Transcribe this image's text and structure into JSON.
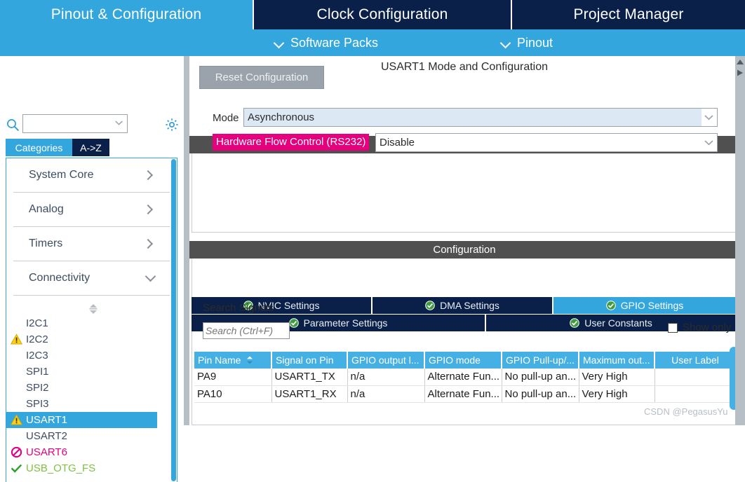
{
  "main_tabs": [
    {
      "label": "Pinout & Configuration",
      "active": true
    },
    {
      "label": "Clock Configuration",
      "active": false
    },
    {
      "label": "Project Manager",
      "active": false
    }
  ],
  "sub_tabs": [
    {
      "label": "Software Packs",
      "icon": "chevron-down-icon"
    },
    {
      "label": "Pinout",
      "icon": "chevron-down-icon"
    }
  ],
  "left_panel": {
    "search": {
      "value": "",
      "placeholder": "",
      "icon": "search-icon"
    },
    "settings_icon": "gear-icon",
    "view_tabs": [
      {
        "label": "Categories",
        "selected": true
      },
      {
        "label": "A->Z",
        "selected": false
      }
    ],
    "categories": [
      {
        "label": "System Core",
        "state": "collapsed"
      },
      {
        "label": "Analog",
        "state": "collapsed"
      },
      {
        "label": "Timers",
        "state": "collapsed"
      },
      {
        "label": "Connectivity",
        "state": "expanded"
      }
    ],
    "peripherals": [
      {
        "label": "I2C1",
        "badge": "none",
        "selected": false
      },
      {
        "label": "I2C2",
        "badge": "warning",
        "selected": false
      },
      {
        "label": "I2C3",
        "badge": "none",
        "selected": false
      },
      {
        "label": "SPI1",
        "badge": "none",
        "selected": false
      },
      {
        "label": "SPI2",
        "badge": "none",
        "selected": false
      },
      {
        "label": "SPI3",
        "badge": "none",
        "selected": false
      },
      {
        "label": "USART1",
        "badge": "warning",
        "selected": true
      },
      {
        "label": "USART2",
        "badge": "none",
        "selected": false
      },
      {
        "label": "USART6",
        "badge": "blocked",
        "selected": false
      },
      {
        "label": "USB_OTG_FS",
        "badge": "check",
        "selected": false
      }
    ]
  },
  "right_panel": {
    "title": "USART1 Mode and Configuration",
    "mode_section": {
      "header": "Mode",
      "fields": [
        {
          "label": "Mode",
          "value": "Asynchronous",
          "highlight": false
        },
        {
          "label": "Hardware Flow Control (RS232)",
          "value": "Disable",
          "highlight": true
        }
      ]
    },
    "config_section": {
      "header": "Configuration",
      "reset_button": "Reset Configuration",
      "tabs_row1": [
        {
          "label": "NVIC Settings",
          "active": false
        },
        {
          "label": "DMA Settings",
          "active": false
        },
        {
          "label": "GPIO Settings",
          "active": true
        }
      ],
      "tabs_row2": [
        {
          "label": "Parameter Settings",
          "active": false
        },
        {
          "label": "User Constants",
          "active": false
        }
      ],
      "search_signals_label": "Search Signals",
      "search_signals_placeholder": "Search (Ctrl+F)",
      "show_only_label": "Show only",
      "show_only_checked": false,
      "table": {
        "columns": [
          "Pin Name",
          "Signal on Pin",
          "GPIO output l...",
          "GPIO mode",
          "GPIO Pull-up/...",
          "Maximum out...",
          "User Label"
        ],
        "sort_column": "Pin Name",
        "rows": [
          [
            "PA9",
            "USART1_TX",
            "n/a",
            "Alternate Fun...",
            "No pull-up an...",
            "Very High",
            ""
          ],
          [
            "PA10",
            "USART1_RX",
            "n/a",
            "Alternate Fun...",
            "No pull-up an...",
            "Very High",
            ""
          ]
        ]
      }
    }
  },
  "watermark": "CSDN @PegasusYu",
  "colors": {
    "accent_blue": "#33a7dd",
    "dark_navy": "#0b2049",
    "magenta": "#e6007e",
    "section_gray": "#505050",
    "table_header_blue": "#45b0e3"
  }
}
